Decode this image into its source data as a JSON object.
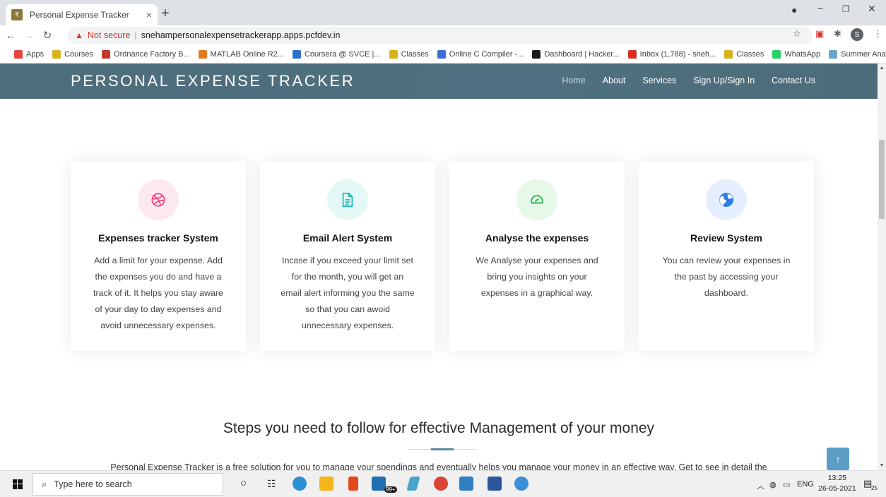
{
  "browser": {
    "tab_title": "Personal Expense Tracker",
    "new_tab": "+",
    "close_tab": "×",
    "url_warning": "Not secure",
    "url": "snehampersonalexpensetrackerapp.apps.pcfdev.in",
    "profile_initial": "S",
    "bookmarks": [
      {
        "label": "Apps",
        "color": "#e8453c"
      },
      {
        "label": "Courses",
        "color": "#d9b21a"
      },
      {
        "label": "Ordnance Factory B...",
        "color": "#c0392b"
      },
      {
        "label": "MATLAB Online R2...",
        "color": "#e07b1a"
      },
      {
        "label": "Coursera @ SVCE |...",
        "color": "#2a73cc"
      },
      {
        "label": "Classes",
        "color": "#d9b21a"
      },
      {
        "label": "Online C Compiler -...",
        "color": "#3b6fd4"
      },
      {
        "label": "Dashboard | Hacker...",
        "color": "#1b1b1b"
      },
      {
        "label": "Inbox (1,788) - sneh...",
        "color": "#d93025"
      },
      {
        "label": "Classes",
        "color": "#d9b21a"
      },
      {
        "label": "WhatsApp",
        "color": "#25d366"
      },
      {
        "label": "Summer Analytics 2...",
        "color": "#6aa5cc"
      }
    ]
  },
  "site": {
    "brand": "PERSONAL EXPENSE TRACKER",
    "nav": [
      "Home",
      "About",
      "Services",
      "Sign Up/Sign In",
      "Contact Us"
    ],
    "cards": [
      {
        "icon": "dribbble-icon",
        "title": "Expenses tracker System",
        "text": "Add a limit for your expense. Add the expenses you do and have a track of it. It helps you stay aware of your day to day expenses and avoid unnecessary expenses.",
        "icon_color": "#f1407a",
        "bg": "#fde8ef"
      },
      {
        "icon": "document-icon",
        "title": "Email Alert System",
        "text": "Incase if you exceed your limit set for the month, you will get an email alert informing you the same so that you can awoid unnecessary expenses.",
        "icon_color": "#16b6ad",
        "bg": "#e4f8f7"
      },
      {
        "icon": "speedometer-icon",
        "title": "Analyse the expenses",
        "text": "We Analyse your expenses and bring you insights on your expenses in a graphical way.",
        "icon_color": "#2ab44a",
        "bg": "#e6f9e9"
      },
      {
        "icon": "globe-icon",
        "title": "Review System",
        "text": "You can review your expenses in the past by accessing your dashboard.",
        "icon_color": "#2e7de0",
        "bg": "#e5efff"
      }
    ],
    "steps_title": "Steps you need to follow for effective Management of your money",
    "steps_desc": "Personal Expense Tracker is a free solution for you to manage your spendings and eventually helps you manage your money in an effective way. Get to see in detail the",
    "back_to_top": "↑"
  },
  "taskbar": {
    "search_placeholder": "Type here to search",
    "language": "ENG",
    "time": "13:25",
    "date": "26-05-2021",
    "notification_count": "25",
    "badge_count": "99+"
  }
}
